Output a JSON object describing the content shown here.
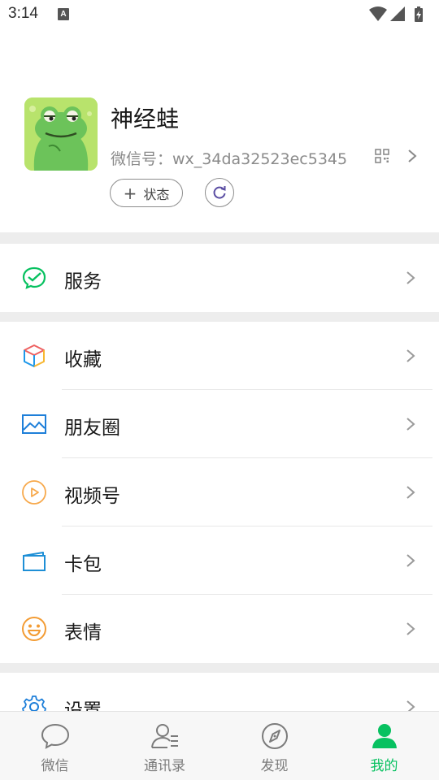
{
  "status_bar": {
    "time": "3:14",
    "notification_letter": "A"
  },
  "profile": {
    "name": "神经蛙",
    "wechat_id": "微信号：wx_34da32523ec5345",
    "status_button": {
      "plus": "+",
      "label": "状态"
    }
  },
  "menu": [
    {
      "label": "服务",
      "icon": "service-check-icon"
    },
    {
      "label": "收藏",
      "icon": "favorites-cube-icon"
    },
    {
      "label": "朋友圈",
      "icon": "moments-image-icon"
    },
    {
      "label": "视频号",
      "icon": "channels-play-icon"
    },
    {
      "label": "卡包",
      "icon": "card-wallet-icon"
    },
    {
      "label": "表情",
      "icon": "sticker-smile-icon"
    },
    {
      "label": "设置",
      "icon": "settings-gear-icon"
    }
  ],
  "tabs": [
    {
      "label": "微信",
      "icon": "chat-bubble-icon",
      "active": false
    },
    {
      "label": "通讯录",
      "icon": "contacts-icon",
      "active": false
    },
    {
      "label": "发现",
      "icon": "compass-icon",
      "active": false
    },
    {
      "label": "我的",
      "icon": "person-icon",
      "active": true
    }
  ],
  "colors": {
    "accent": "#07c160",
    "section_gap": "#ededed",
    "tab_bar": "#f7f7f7"
  }
}
